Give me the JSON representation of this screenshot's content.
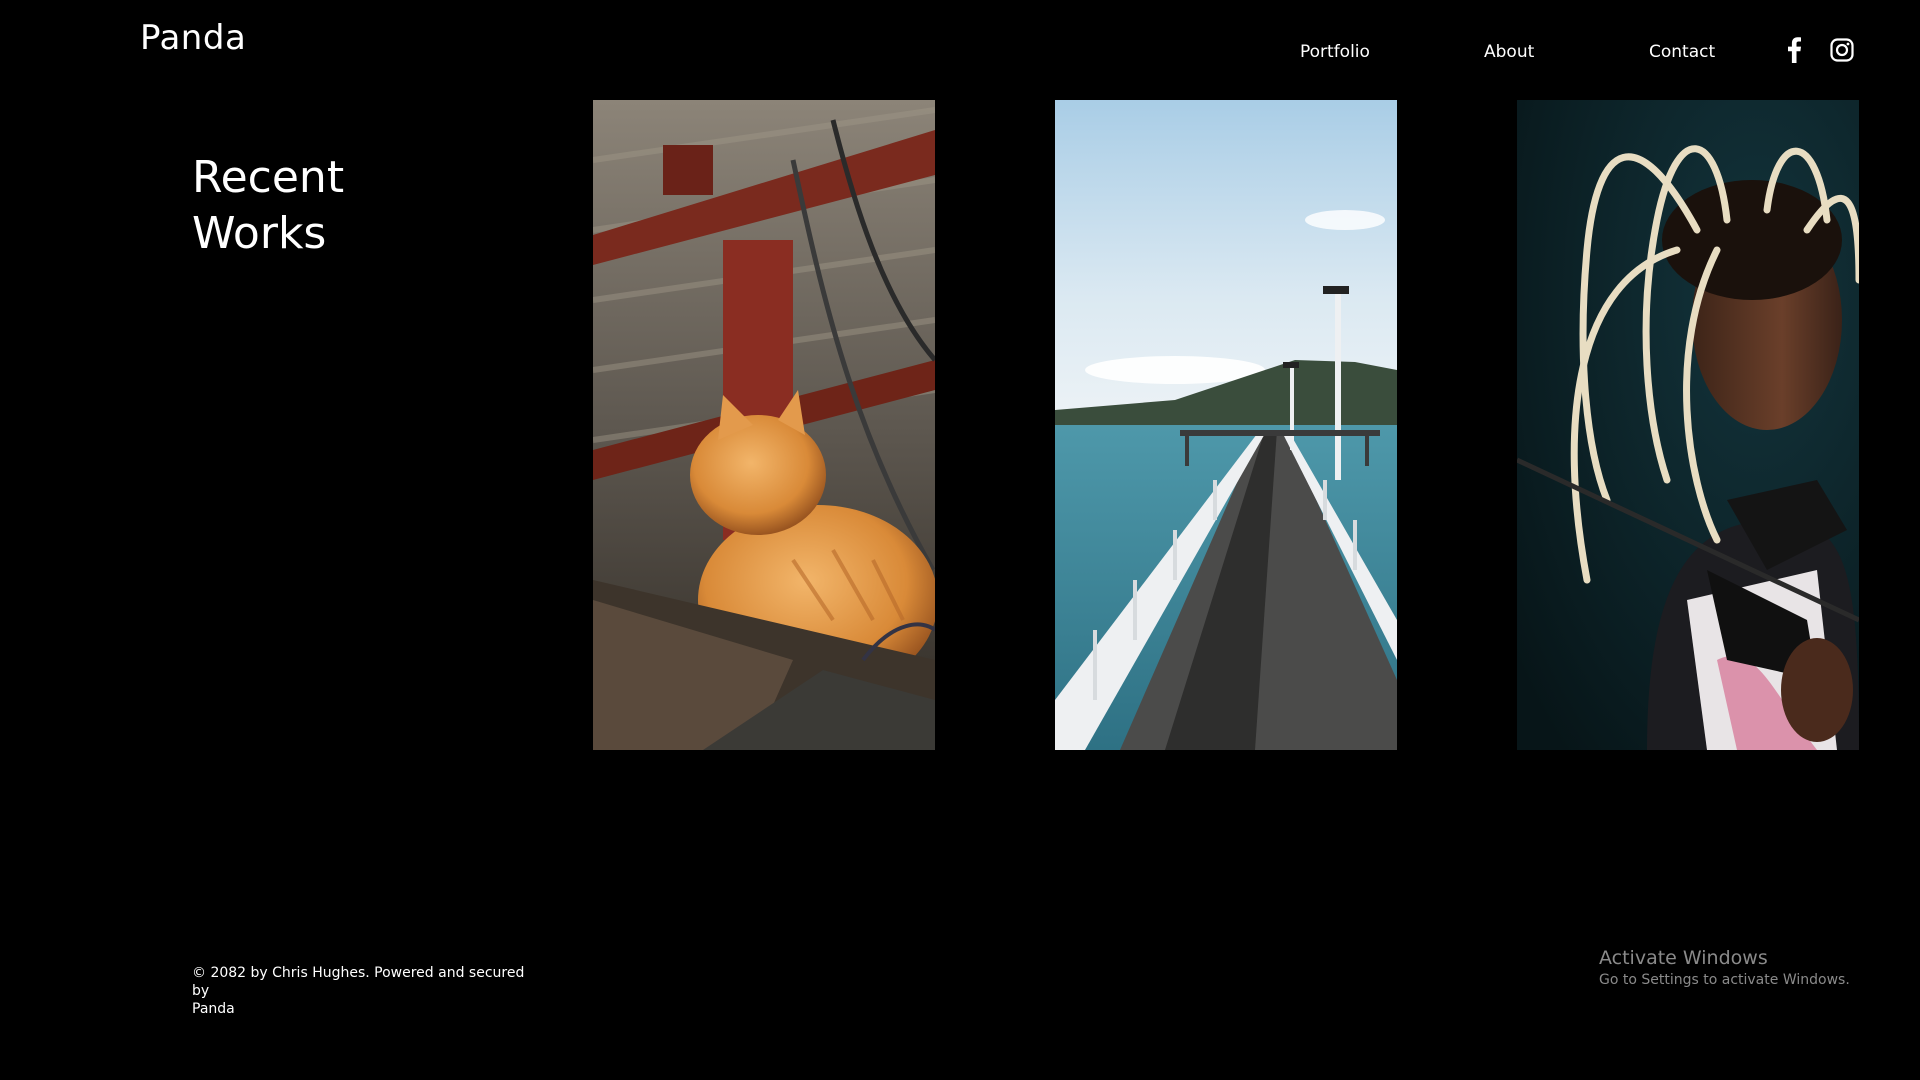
{
  "header": {
    "logo": "Panda",
    "nav": [
      {
        "label": "Portfolio"
      },
      {
        "label": "About"
      },
      {
        "label": "Contact"
      }
    ],
    "social": [
      "facebook-icon",
      "instagram-icon"
    ]
  },
  "main": {
    "heading_line1": "Recent",
    "heading_line2": "Works",
    "gallery": [
      {
        "subject": "orange-cat-photo"
      },
      {
        "subject": "pier-photo"
      },
      {
        "subject": "portrait-photo"
      }
    ]
  },
  "footer": {
    "line1": "© 2082 by Chris Hughes. Powered and secured by",
    "line2": "Panda"
  },
  "os_watermark": {
    "title": "Activate Windows",
    "subtitle": "Go to Settings to activate Windows."
  },
  "colors": {
    "background": "#000000",
    "text": "#ffffff",
    "watermark": "#8a8a8a"
  }
}
